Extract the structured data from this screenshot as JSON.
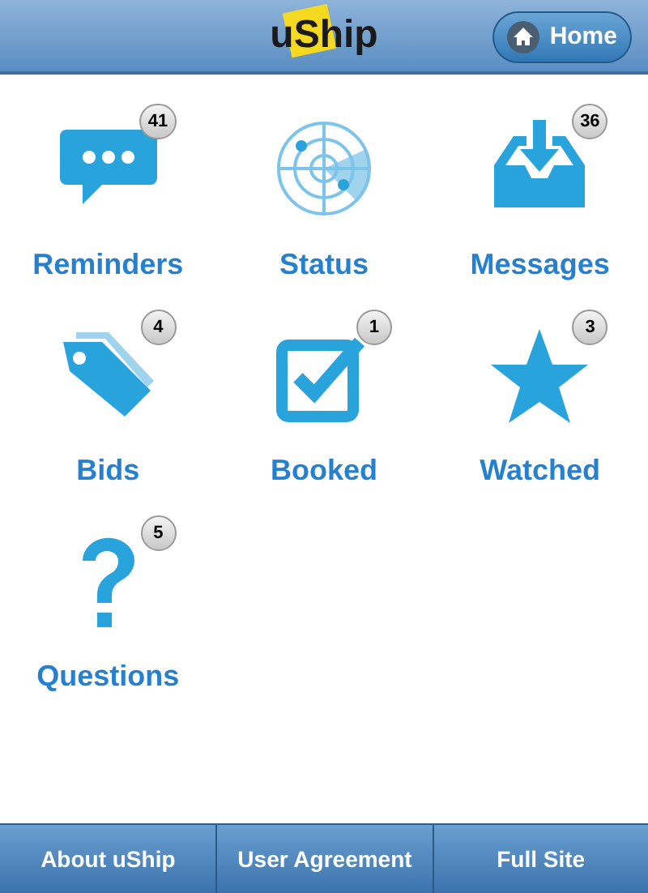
{
  "header": {
    "logo": "uShip",
    "home_button": "Home"
  },
  "tiles": [
    {
      "kind": "chat",
      "label": "Reminders",
      "badge": "41"
    },
    {
      "kind": "radar",
      "label": "Status"
    },
    {
      "kind": "inbox",
      "label": "Messages",
      "badge": "36"
    },
    {
      "kind": "tag",
      "label": "Bids",
      "badge": "4"
    },
    {
      "kind": "check",
      "label": "Booked",
      "badge": "1"
    },
    {
      "kind": "star",
      "label": "Watched",
      "badge": "3"
    },
    {
      "kind": "question",
      "label": "Questions",
      "badge": "5"
    }
  ],
  "footer": [
    "About uShip",
    "User Agreement",
    "Full Site"
  ]
}
